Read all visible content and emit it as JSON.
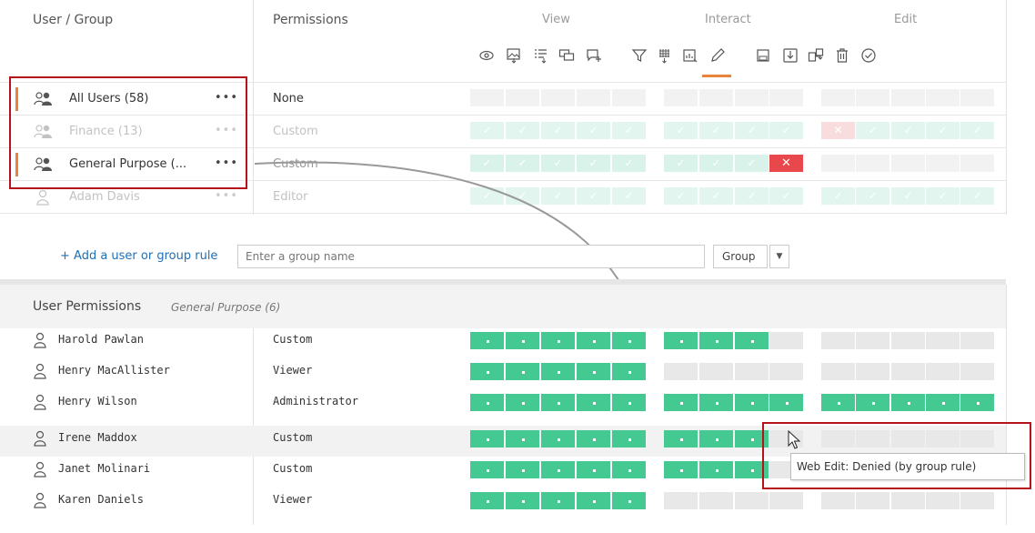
{
  "header": {
    "user_group": "User / Group",
    "permissions": "Permissions",
    "view": "View",
    "interact": "Interact",
    "edit": "Edit"
  },
  "capability_icons": [
    "view-icon",
    "download-image-icon",
    "download-summary-icon",
    "view-comments-icon",
    "add-comment-icon",
    "filter-icon",
    "download-data-icon",
    "share-customized-icon",
    "web-edit-icon",
    "download-workbook-icon",
    "save-icon",
    "move-icon",
    "delete-icon",
    "set-permissions-icon"
  ],
  "group_rules": [
    {
      "name": "All Users (58)",
      "permission": "None"
    },
    {
      "name": "Finance (13)",
      "permission": "Custom"
    },
    {
      "name": "General Purpose (...",
      "permission": "Custom"
    },
    {
      "name": "Adam Davis",
      "permission": "Editor"
    }
  ],
  "add_rule": {
    "link": "+ Add a user or group rule",
    "placeholder": "Enter a group name",
    "type": "Group"
  },
  "user_permissions": {
    "title": "User Permissions",
    "subtitle": "General Purpose (6)",
    "users": [
      {
        "name": "Harold Pawlan",
        "role": "Custom"
      },
      {
        "name": "Henry MacAllister",
        "role": "Viewer"
      },
      {
        "name": "Henry Wilson",
        "role": "Administrator"
      },
      {
        "name": "Irene Maddox",
        "role": "Custom"
      },
      {
        "name": "Janet Molinari",
        "role": "Custom"
      },
      {
        "name": "Karen Daniels",
        "role": "Viewer"
      }
    ]
  },
  "tooltip": "Web Edit: Denied (by group rule)",
  "colors": {
    "allow": "#44c992",
    "deny": "#e8474b",
    "accent": "#e8833a",
    "highlight": "#b5121b",
    "link": "#1f6fb5"
  }
}
